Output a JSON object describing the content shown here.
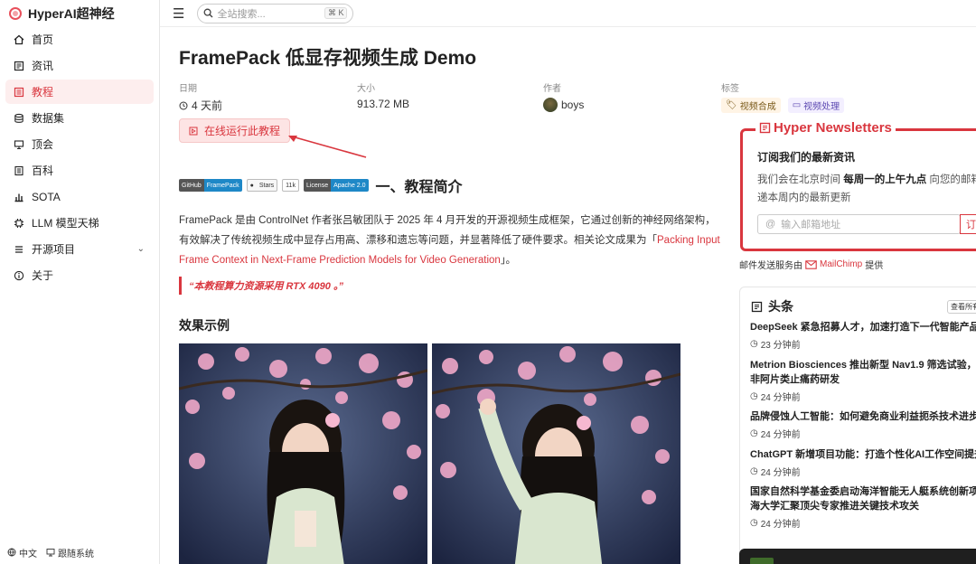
{
  "brand": {
    "name": "HyperAI超神经"
  },
  "sidebar": {
    "items": [
      {
        "label": "首页",
        "icon": "home-icon"
      },
      {
        "label": "资讯",
        "icon": "news-icon"
      },
      {
        "label": "教程",
        "icon": "tutorial-icon",
        "active": true
      },
      {
        "label": "数据集",
        "icon": "database-icon"
      },
      {
        "label": "顶会",
        "icon": "conference-icon"
      },
      {
        "label": "百科",
        "icon": "wiki-icon"
      },
      {
        "label": "SOTA",
        "icon": "chart-icon"
      },
      {
        "label": "LLM 模型天梯",
        "icon": "llm-icon"
      },
      {
        "label": "开源项目",
        "icon": "open-source-icon",
        "expandable": true
      },
      {
        "label": "关于",
        "icon": "info-icon"
      }
    ],
    "footer": {
      "language": "中文",
      "theme": "跟随系统"
    }
  },
  "search": {
    "placeholder": "全站搜索...",
    "shortcut": "⌘ K"
  },
  "article": {
    "title": "FramePack 低显存视频生成 Demo",
    "meta": {
      "date_label": "日期",
      "date_value": "4 天前",
      "size_label": "大小",
      "size_value": "913.72 MB",
      "author_label": "作者",
      "author_value": "boys",
      "tags_label": "标签",
      "tags": [
        "视频合成",
        "视频处理"
      ]
    },
    "run_button": "在线运行此教程",
    "badges": {
      "github_l": "GitHub",
      "github_r": "FramePack",
      "stars": "Stars",
      "stars_count": "11k",
      "license_l": "License",
      "license_r": "Apache 2.0"
    },
    "section_heading": "一、教程简介",
    "paragraph_part1": "FramePack 是由 ControlNet 作者张吕敏团队于 2025 年 4 月开发的开源视频生成框架，它通过创新的神经网络架构，有效解决了传统视频生成中显存占用高、漂移和遗忘等问题，并显著降低了硬件要求。相关论文成果为「",
    "paragraph_link": "Packing Input Frame Context in Next-Frame Prediction Models for Video Generation",
    "paragraph_part2": "」。",
    "quote": "“本教程算力资源采用 RTX 4090 。”",
    "examples_heading": "效果示例"
  },
  "newsletter": {
    "title": "Hyper Newsletters",
    "subtitle": "订阅我们的最新资讯",
    "desc_part1": "我们会在北京时间 ",
    "desc_bold": "每周一的上午九点",
    "desc_part2": " 向您的邮箱投递本周内的最新更新",
    "input_placeholder": "输入邮箱地址",
    "button": "订",
    "provider_prefix": "邮件发送服务由",
    "provider_name": "MailChimp",
    "provider_suffix": "提供"
  },
  "headlines": {
    "title": "头条",
    "more": "查看所有",
    "items": [
      {
        "title": "DeepSeek 紧急招募人才，加速打造下一代智能产品",
        "time": "23 分钟前"
      },
      {
        "title": "Metrion Biosciences 推出新型 Nav1.9 筛选试验，助",
        "title2": "非阿片类止痛药研发",
        "time": "24 分钟前"
      },
      {
        "title": "品牌侵蚀人工智能：如何避免商业利益扼杀技术进步",
        "time": "24 分钟前"
      },
      {
        "title": "ChatGPT 新增项目功能：打造个性化AI工作空间提升",
        "time": "24 分钟前"
      },
      {
        "title": "国家自然科学基金委启动海洋智能无人艇系统创新项",
        "title2": "海大学汇聚顶尖专家推进关键技术攻关",
        "time": "24 分钟前"
      }
    ]
  }
}
